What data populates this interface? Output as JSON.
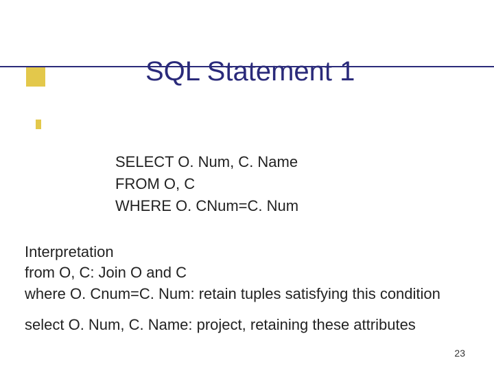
{
  "title": "SQL Statement 1",
  "sql": {
    "line1": "SELECT O. Num, C. Name",
    "line2": "FROM O, C",
    "line3": "WHERE O. CNum=C. Num"
  },
  "interpretation": {
    "heading": "Interpretation",
    "line1": "from O, C: Join O and C",
    "line2": "where O. Cnum=C. Num: retain tuples satisfying this condition"
  },
  "projection": "select O. Num, C. Name: project, retaining these attributes",
  "page_number": "23"
}
